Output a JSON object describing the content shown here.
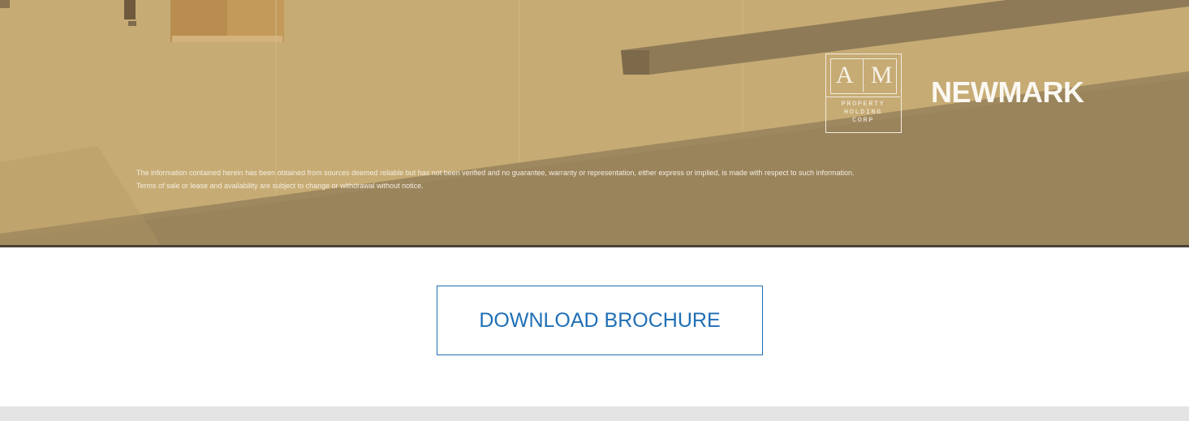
{
  "hero": {
    "logo_am": {
      "letter_left": "A",
      "letter_right": "M",
      "sub_lines": [
        "PROPERTY",
        "HOLDING",
        "CORP"
      ]
    },
    "brand": "NEWMARK",
    "disclaimer_line1": "The information contained herein has been obtained from sources deemed reliable but has not been verified and no guarantee, warranty or representation, either express or implied, is made with respect to such information.",
    "disclaimer_line2": "Terms of sale or lease and availability are subject to change or withdrawal without notice."
  },
  "actions": {
    "download_label": "DOWNLOAD BROCHURE"
  },
  "colors": {
    "hero_tan": "#c2a670",
    "hero_dark": "#9a845c",
    "button_blue": "#1f6fb5",
    "footer_gray": "#e4e4e4"
  }
}
